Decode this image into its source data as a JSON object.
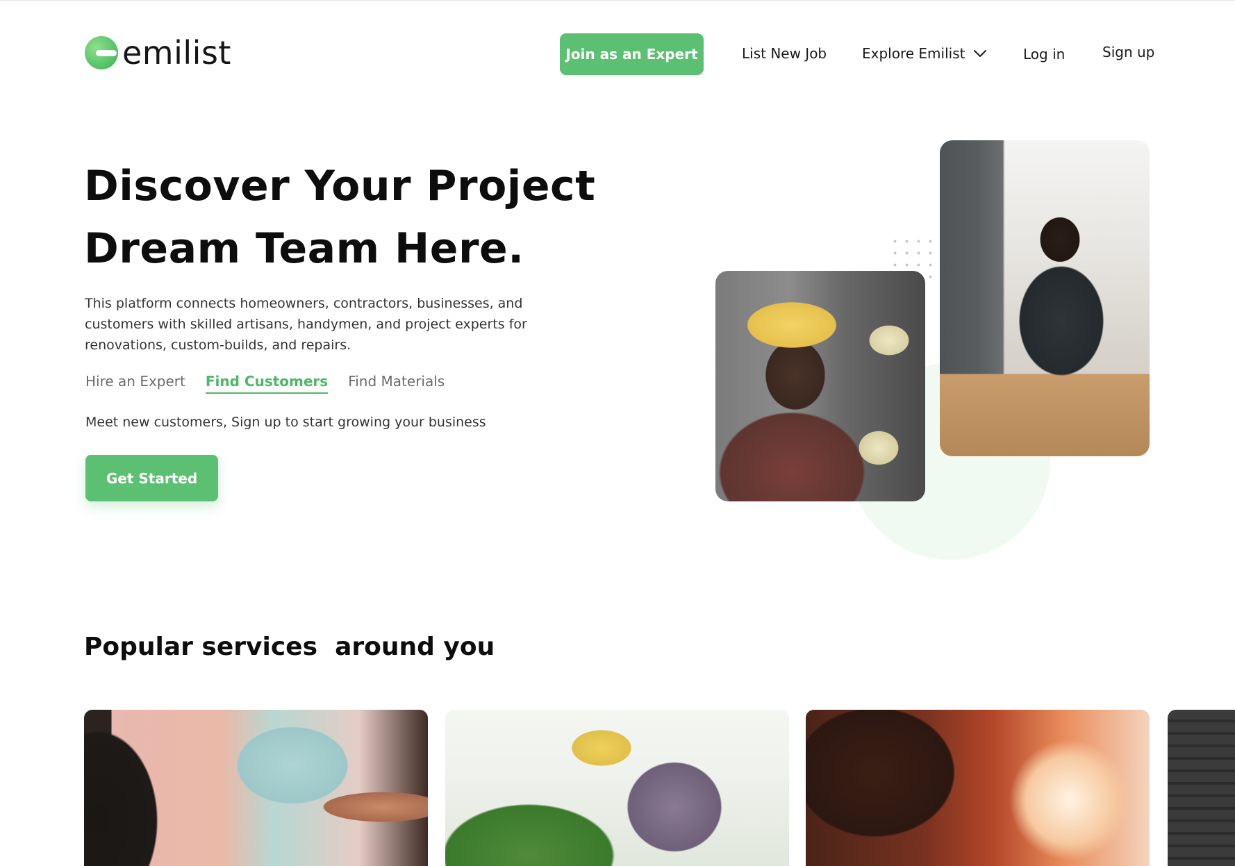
{
  "brand": {
    "name": "emilist",
    "accent_color": "#5cc072"
  },
  "nav": {
    "join_label": "Join as an Expert",
    "list_job_label": "List New Job",
    "explore_label": "Explore Emilist",
    "login_label": "Log in",
    "signup_label": "Sign up"
  },
  "hero": {
    "title_line1": "Discover Your Project",
    "title_line2": "Dream Team Here.",
    "description": "This platform connects homeowners, contractors, businesses, and customers with skilled artisans, handymen, and project experts for renovations, custom-builds, and repairs.",
    "tabs": [
      {
        "label": "Hire an Expert",
        "active": false
      },
      {
        "label": "Find Customers",
        "active": true
      },
      {
        "label": "Find Materials",
        "active": false
      }
    ],
    "subtext": "Meet new customers,  Sign up to start growing your business",
    "cta_label": "Get Started"
  },
  "popular": {
    "title": "Popular services  around you"
  }
}
